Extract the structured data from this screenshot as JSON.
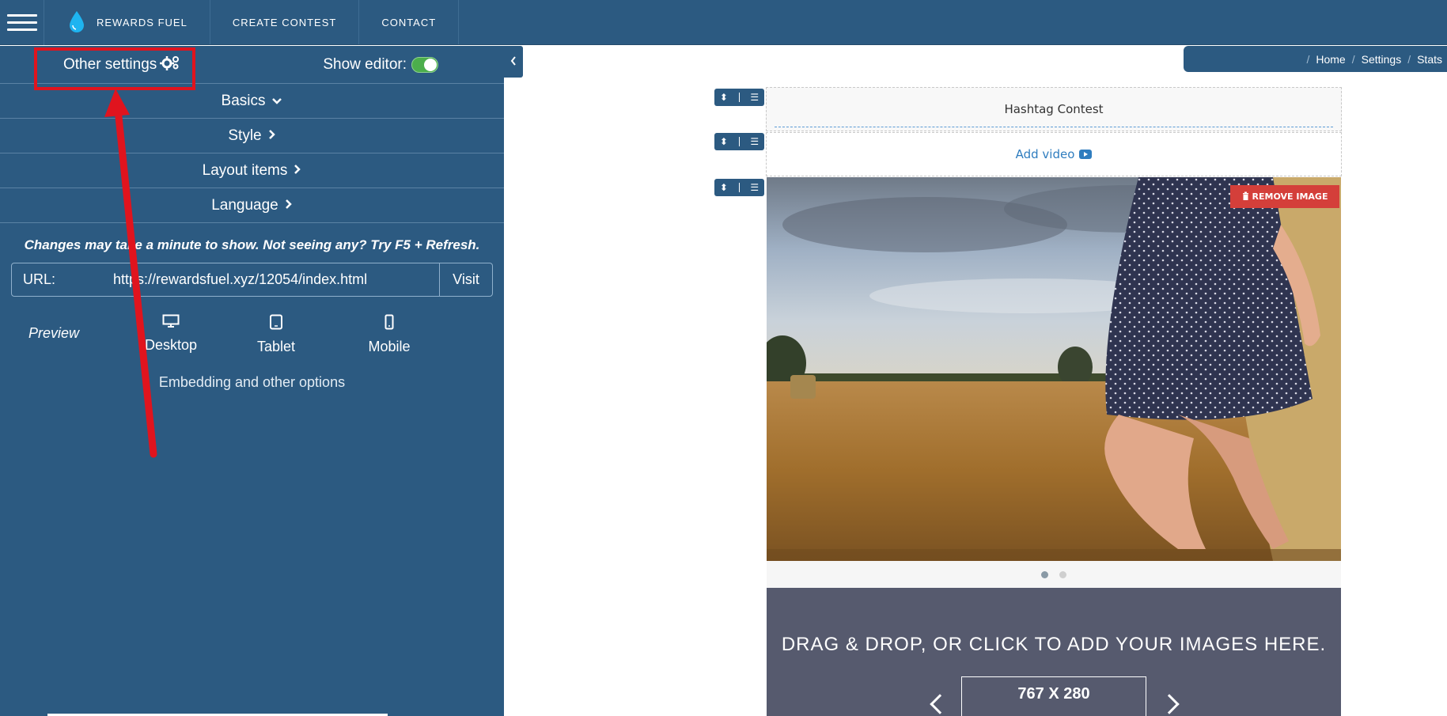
{
  "topnav": {
    "brand": "REWARDS FUEL",
    "links": [
      "CREATE CONTEST",
      "CONTACT"
    ]
  },
  "panel": {
    "other_settings": "Other settings",
    "show_editor": "Show editor:",
    "show_editor_on": true,
    "sections": [
      "Basics",
      "Style",
      "Layout items",
      "Language"
    ],
    "notice": "Changes may take a minute to show. Not seeing any? Try F5 + Refresh.",
    "url_label": "URL:",
    "url_value": "https://rewardsfuel.xyz/12054/index.html",
    "visit": "Visit",
    "preview_label": "Preview",
    "devices": [
      "Desktop",
      "Tablet",
      "Mobile"
    ],
    "embed": "Embedding and other options"
  },
  "breadcrumb": [
    "Home",
    "Settings",
    "Stats"
  ],
  "editor": {
    "title": "Hashtag Contest",
    "add_video": "Add video",
    "remove_image": "REMOVE IMAGE",
    "slides": 2,
    "active_slide": 1,
    "upload_text": "DRAG & DROP, OR CLICK TO ADD YOUR IMAGES HERE.",
    "dimensions": "767 X 280"
  },
  "colors": {
    "nav": "#2c5a81",
    "accent_red": "#d43f3a",
    "toggle_green": "#4cae4c",
    "annotation": "#e0141e",
    "upload_bg": "#565a6e"
  },
  "icons": [
    "menu-icon",
    "water-drop-icon",
    "gears-icon",
    "chevron-down-icon",
    "chevron-right-icon",
    "chevron-left-icon",
    "desktop-icon",
    "tablet-icon",
    "mobile-icon",
    "sort-icon",
    "list-icon",
    "trash-icon",
    "youtube-icon"
  ]
}
